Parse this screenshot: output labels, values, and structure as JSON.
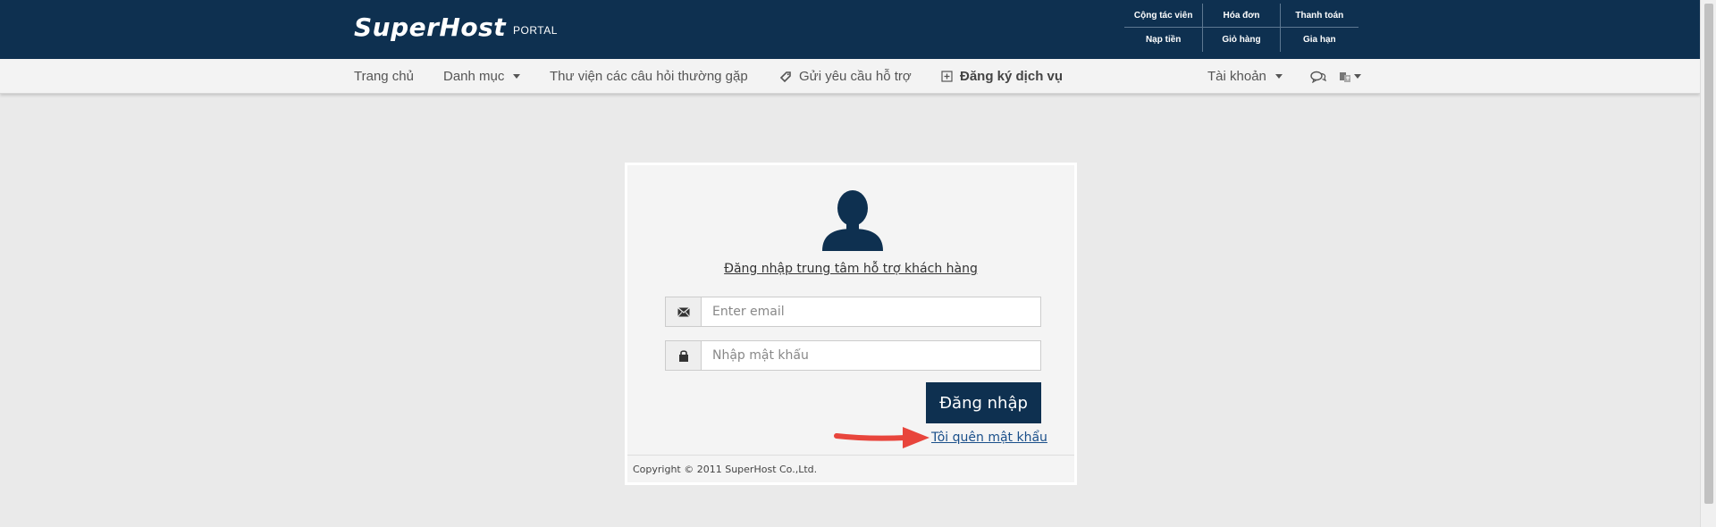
{
  "header": {
    "logo": "SuperHost",
    "logo_sub": "PORTAL",
    "quick_links": [
      {
        "label": "Cộng tác viên"
      },
      {
        "label": "Hóa đơn"
      },
      {
        "label": "Thanh toán"
      },
      {
        "label": "Nạp tiền"
      },
      {
        "label": "Giỏ hàng"
      },
      {
        "label": "Gia hạn"
      }
    ]
  },
  "nav": {
    "home": "Trang chủ",
    "category": "Danh mục",
    "faq": "Thư viện các câu hỏi thường gặp",
    "support": "Gửi yêu cầu hỗ trợ",
    "register": "Đăng ký dịch vụ",
    "account": "Tài khoản",
    "icons": {
      "support": "ticket-icon",
      "register": "plus-square-icon",
      "chat": "chat-icon",
      "language": "language-icon"
    }
  },
  "login": {
    "title": "Đăng nhập trung tâm hỗ trợ khách hàng",
    "email_placeholder": "Enter email",
    "email_value": "",
    "password_placeholder": "Nhập mật khẩu",
    "password_value": "",
    "submit": "Đăng nhập",
    "forgot": "Tôi quên mật khẩu",
    "copyright": "Copyright © 2011 SuperHost Co.,Ltd.",
    "icons": {
      "avatar": "user-silhouette-icon",
      "email": "envelope-icon",
      "password": "lock-icon"
    }
  },
  "colors": {
    "brand": "#0e3050",
    "background": "#eaeaea",
    "annotation_arrow": "#e8453c"
  }
}
